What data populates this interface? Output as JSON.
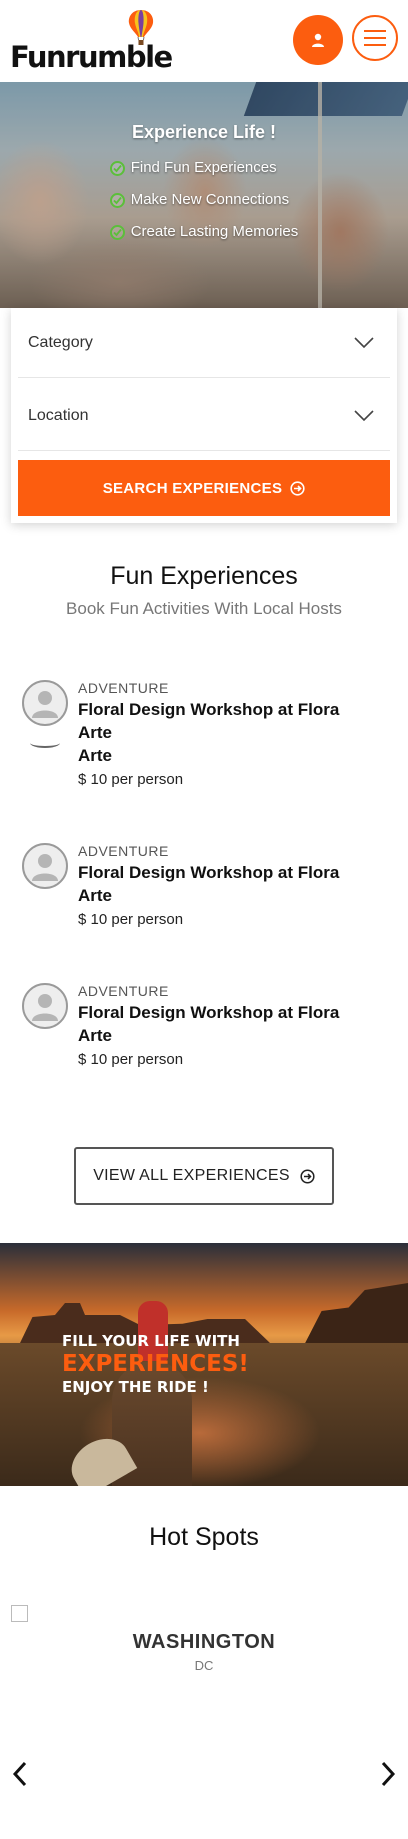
{
  "header": {
    "logo_text": "Funrumble"
  },
  "hero": {
    "title": "Experience Life !",
    "bullets": [
      "Find Fun Experiences",
      "Make New Connections",
      "Create Lasting Memories"
    ]
  },
  "search": {
    "category_label": "Category",
    "location_label": "Location",
    "button_label": "SEARCH EXPERIENCES"
  },
  "experiences_section": {
    "title": "Fun Experiences",
    "subtitle": "Book Fun Activities With Local Hosts",
    "items": [
      {
        "category": "ADVENTURE",
        "title_line1": "Floral Design Workshop at Flora",
        "title_line2": "Arte",
        "title_line3": "Arte",
        "price": "$ 10 per person"
      },
      {
        "category": "ADVENTURE",
        "title_line1": "Floral Design Workshop at Flora",
        "title_line2": "Arte",
        "price": "$ 10 per person"
      },
      {
        "category": "ADVENTURE",
        "title_line1": "Floral Design Workshop at Flora",
        "title_line2": "Arte",
        "price": "$ 10 per person"
      }
    ],
    "view_all_label": "VIEW ALL EXPERIENCES"
  },
  "banner": {
    "line1": "FILL YOUR LIFE WITH",
    "line2": "EXPERIENCES!",
    "line3": "ENJOY THE RIDE !"
  },
  "hot_spots": {
    "title": "Hot Spots",
    "spot_name": "WASHINGTON",
    "spot_sub": "DC"
  },
  "colors": {
    "accent": "#fc5d0f",
    "check_green": "#5bbf3a"
  }
}
